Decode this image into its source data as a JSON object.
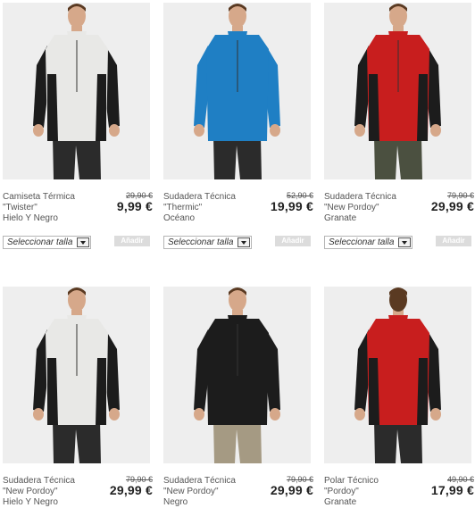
{
  "products": [
    {
      "name_line1": "Camiseta Térmica",
      "name_line2": "\"Twister\"",
      "color": "Hielo Y Negro",
      "old_price": "29,90 €",
      "new_price": "9,99 €",
      "size_placeholder": "Seleccionar talla",
      "add_label": "Añadir",
      "garment": "top-white",
      "pants": "dark",
      "bg": "#eeeeee"
    },
    {
      "name_line1": "Sudadera Técnica",
      "name_line2": "\"Thermic\"",
      "color": "Océano",
      "old_price": "52,90 €",
      "new_price": "19,99 €",
      "size_placeholder": "Seleccionar talla",
      "add_label": "Añadir",
      "garment": "jacket-blue",
      "pants": "dark",
      "bg": "#eeeeee"
    },
    {
      "name_line1": "Sudadera Técnica",
      "name_line2": "\"New Pordoy\"",
      "color": "Granate",
      "old_price": "79,90 €",
      "new_price": "29,99 €",
      "size_placeholder": "Seleccionar talla",
      "add_label": "Añadir",
      "garment": "fleece-red",
      "pants": "olive",
      "bg": "#eeeeee"
    },
    {
      "name_line1": "Sudadera Técnica",
      "name_line2": "\"New Pordoy\"",
      "color": "Hielo Y Negro",
      "old_price": "79,90 €",
      "new_price": "29,99 €",
      "garment": "fleece-white",
      "pants": "dark",
      "bg": "#eeeeee"
    },
    {
      "name_line1": "Sudadera Técnica",
      "name_line2": "\"New Pordoy\"",
      "color": "Negro",
      "old_price": "79,90 €",
      "new_price": "29,99 €",
      "garment": "fleece-black",
      "pants": "khaki",
      "bg": "#eeeeee"
    },
    {
      "name_line1": "Polar Técnico",
      "name_line2": "\"Pordoy\"",
      "color": "Granate",
      "old_price": "49,90 €",
      "new_price": "17,99 €",
      "garment": "back-red",
      "pants": "dark",
      "bg": "#eeeeee"
    }
  ],
  "colors": {
    "white_top": "#e8e8e6",
    "blue": "#1f7fc4",
    "red": "#c81e1e",
    "black": "#1c1c1c",
    "dark_pants": "#2b2b2b",
    "olive": "#4b5040",
    "khaki": "#a59a83",
    "skin": "#d6a88a",
    "hair": "#5a3a22"
  }
}
